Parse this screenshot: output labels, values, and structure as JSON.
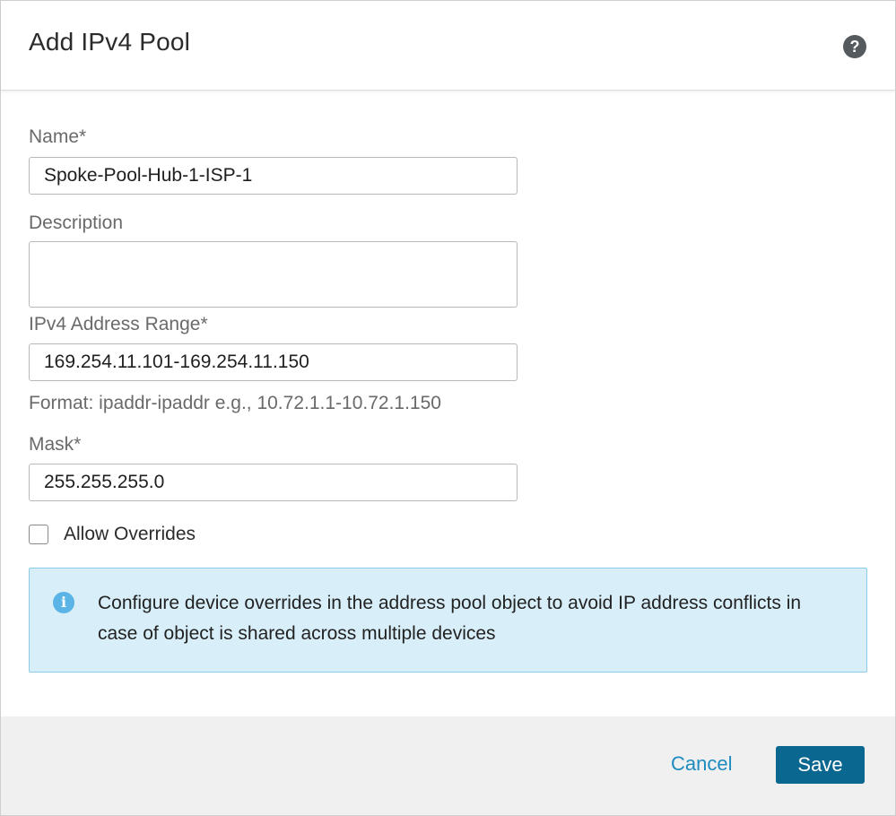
{
  "dialog": {
    "title": "Add IPv4 Pool",
    "help_icon": "question-mark-icon",
    "help_glyph": "?"
  },
  "form": {
    "name": {
      "label": "Name*",
      "value": "Spoke-Pool-Hub-1-ISP-1"
    },
    "description": {
      "label": "Description",
      "value": ""
    },
    "ipv4_range": {
      "label": "IPv4 Address Range*",
      "value": "169.254.11.101-169.254.11.150",
      "hint": "Format: ipaddr-ipaddr e.g., 10.72.1.1-10.72.1.150"
    },
    "mask": {
      "label": "Mask*",
      "value": "255.255.255.0"
    },
    "allow_overrides": {
      "label": "Allow Overrides",
      "checked": false
    }
  },
  "info": {
    "icon": "info-icon",
    "glyph": "i",
    "text": "Configure device overrides in the address pool object to avoid IP address conflicts in case of object is shared across multiple devices"
  },
  "footer": {
    "cancel_label": "Cancel",
    "save_label": "Save"
  },
  "colors": {
    "accent": "#0a6790",
    "link": "#1e8bbf",
    "info_bg": "#d8eef9",
    "info_border": "#8fcbe6",
    "info_icon": "#5ab4e5"
  }
}
